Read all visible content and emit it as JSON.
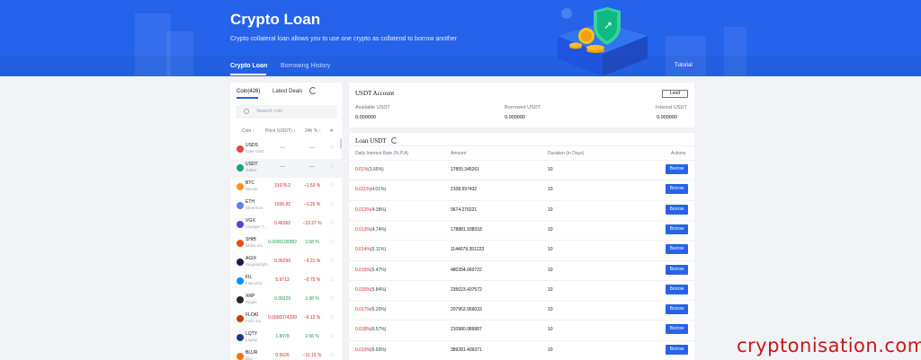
{
  "header": {
    "title": "Crypto Loan",
    "subtitle": "Crypto collateral loan allows you to use one crypto as collateral to borrow another",
    "tabs": [
      {
        "label": "Crypto Loan"
      },
      {
        "label": "Borrowing History"
      }
    ],
    "tutorial": "Tutorial"
  },
  "coin_panel": {
    "tabs": [
      {
        "label": "Coin(426)"
      },
      {
        "label": "Latest Deals"
      }
    ],
    "search_placeholder": "Search coin",
    "columns": [
      "Coin ↕",
      "Price (USDT) ↕",
      "24h % ↕"
    ],
    "coins": [
      {
        "symbol": "USDS",
        "name": "Gate USD",
        "price": "—",
        "change": "—",
        "dir": "dash",
        "color": "#ef4444"
      },
      {
        "symbol": "USDT",
        "name": "Tether",
        "price": "—",
        "change": "—",
        "dir": "dash",
        "color": "#22a079"
      },
      {
        "symbol": "BTC",
        "name": "Bitcoin",
        "price": "31678.2",
        "change": "−1.53 %",
        "dir": "down",
        "color": "#f7931a"
      },
      {
        "symbol": "ETH",
        "name": "Ethereum",
        "price": "1936.82",
        "change": "−1.26 %",
        "dir": "down",
        "color": "#627eea"
      },
      {
        "symbol": "VGX",
        "name": "Voyager T...",
        "price": "0.46362",
        "change": "−10.27 %",
        "dir": "down",
        "color": "#5b3fd6"
      },
      {
        "symbol": "SHIB",
        "name": "Shiba Inu",
        "price": "0.0000109982",
        "change": "3.58 %",
        "dir": "up",
        "color": "#e8501a"
      },
      {
        "symbol": "AGIX",
        "name": "SingularityN...",
        "price": "0.36299",
        "change": "−9.21 %",
        "dir": "down",
        "color": "#1e1b4b"
      },
      {
        "symbol": "FIL",
        "name": "Filecoin(I...",
        "price": "5.9713",
        "change": "−0.75 %",
        "dir": "down",
        "color": "#0090ff"
      },
      {
        "symbol": "XRP",
        "name": "Ripple",
        "price": "0.39329",
        "change": "3.98 %",
        "dir": "up",
        "color": "#23292f"
      },
      {
        "symbol": "FLOKI",
        "name": "Floki Inu",
        "price": "0.0000374399",
        "change": "−9.13 %",
        "dir": "down",
        "color": "#c2410c"
      },
      {
        "symbol": "LQTY",
        "name": "Liquity",
        "price": "1.8478",
        "change": "2.56 %",
        "dir": "up",
        "color": "#1e3a8a"
      },
      {
        "symbol": "BLUR",
        "name": "Blur",
        "price": "0.5626",
        "change": "−11.15 %",
        "dir": "down",
        "color": "#f97316"
      }
    ]
  },
  "account": {
    "title": "USDT Account",
    "lend_label": "Lend",
    "available_label": "Available USDT",
    "available_value": "0.000000",
    "borrowed_label": "Borrowed USDT",
    "borrowed_value": "0.000000",
    "interest_label": "Interest USDT",
    "interest_value": "0.000000"
  },
  "loan": {
    "title": "Loan USDT",
    "columns": [
      "Daily Interest Rate (% P.A)",
      "Amount",
      "Duration (in Days)",
      "Actions"
    ],
    "borrow_label": "Borrow",
    "rows": [
      {
        "rate": "0.01%",
        "apr": "(3.65%)",
        "amount": "17855.345261",
        "duration": "10"
      },
      {
        "rate": "0.011%",
        "apr": "(4.01%)",
        "amount": "2108.697432",
        "duration": "10"
      },
      {
        "rate": "0.012%",
        "apr": "(4.38%)",
        "amount": "9674.270221",
        "duration": "10"
      },
      {
        "rate": "0.013%",
        "apr": "(4.74%)",
        "amount": "178881.938318",
        "duration": "10"
      },
      {
        "rate": "0.014%",
        "apr": "(5.11%)",
        "amount": "1144079.351223",
        "duration": "10"
      },
      {
        "rate": "0.015%",
        "apr": "(5.47%)",
        "amount": "480354.060722",
        "duration": "10"
      },
      {
        "rate": "0.016%",
        "apr": "(5.84%)",
        "amount": "235023.437572",
        "duration": "10"
      },
      {
        "rate": "0.017%",
        "apr": "(6.20%)",
        "amount": "207952.069033",
        "duration": "10"
      },
      {
        "rate": "0.018%",
        "apr": "(6.57%)",
        "amount": "210980.986887",
        "duration": "10"
      },
      {
        "rate": "0.019%",
        "apr": "(6.93%)",
        "amount": "389281.409371",
        "duration": "10"
      }
    ]
  },
  "watermark": "cryptonisation.com",
  "colors": {
    "brand_blue": "#2563eb",
    "up": "#16a34a",
    "down": "#dc2626"
  }
}
